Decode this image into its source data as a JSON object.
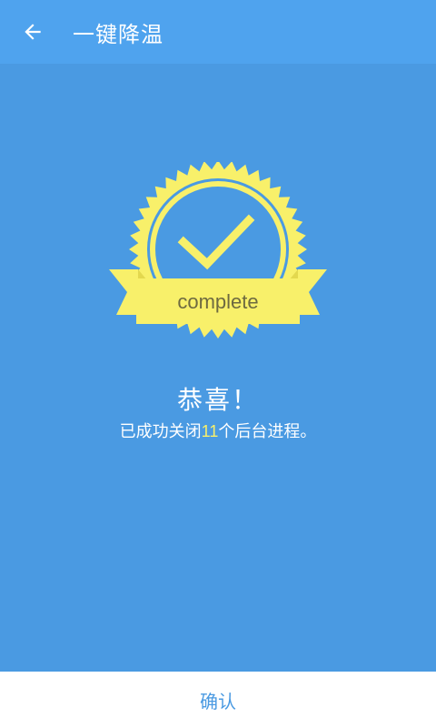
{
  "toolbar": {
    "title": "一键降温",
    "back_icon": "arrow-left-icon"
  },
  "badge": {
    "label": "complete",
    "icon": "checkmark-badge-icon",
    "color": "#f8f06a",
    "text_color": "#6e6a40"
  },
  "message": {
    "title": "恭喜！",
    "result_prefix": "已成功关闭",
    "count": "11",
    "result_suffix": "个后台进程。"
  },
  "bottom": {
    "confirm_label": "确认"
  },
  "colors": {
    "background": "#4a9ae2",
    "toolbar": "#4fa3ee",
    "accent": "#f8f06a"
  }
}
